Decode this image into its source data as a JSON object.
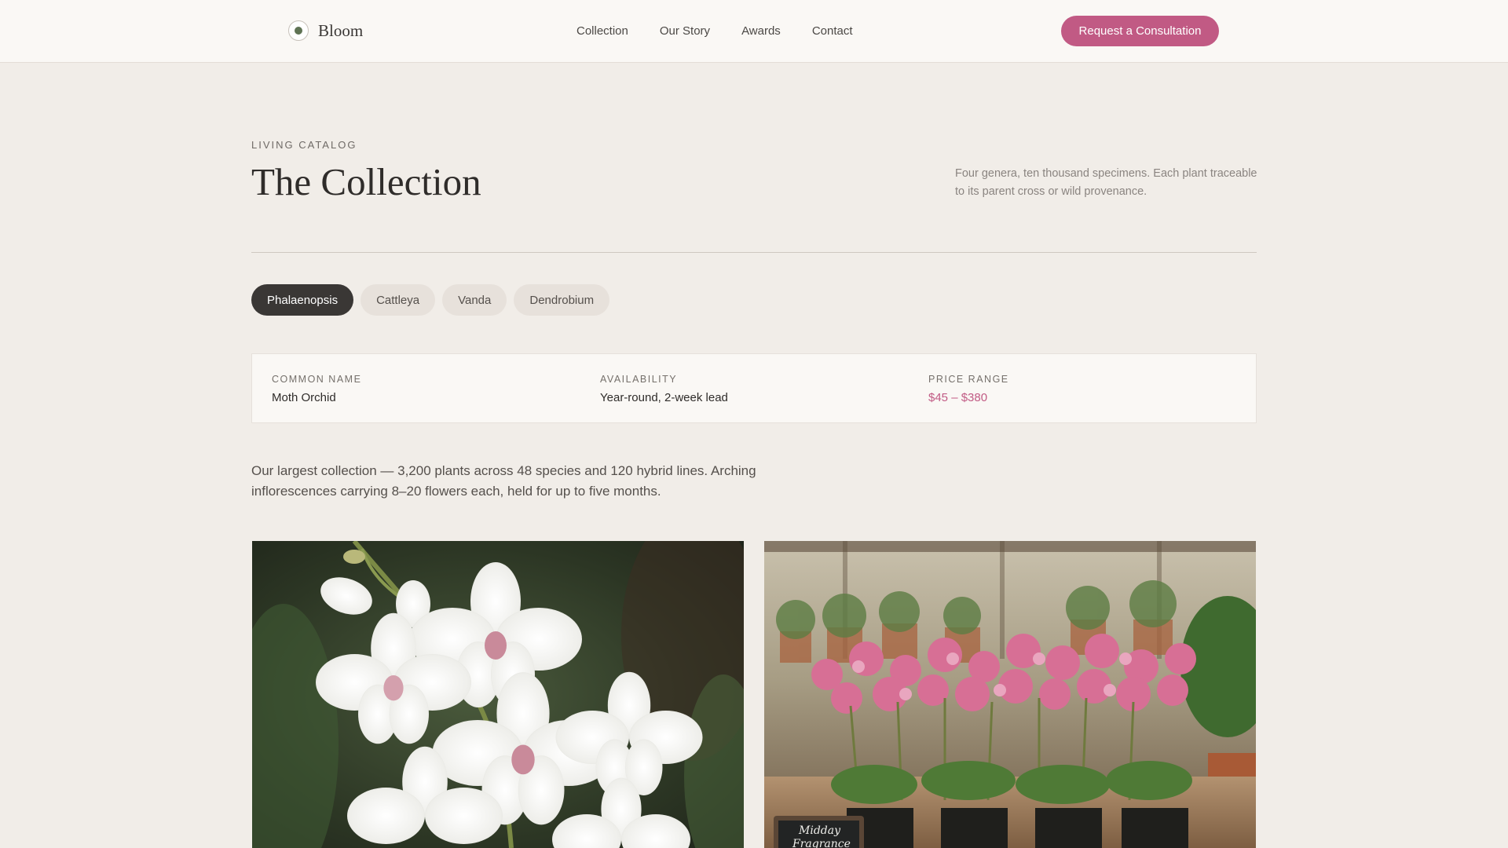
{
  "brand": {
    "name": "Bloom",
    "icon": "logo-mark-icon"
  },
  "nav": {
    "items": [
      "Collection",
      "Our Story",
      "Awards",
      "Contact"
    ]
  },
  "header": {
    "cta_label": "Request a Consultation"
  },
  "hero": {
    "eyebrow": "LIVING CATALOG",
    "title": "The Collection",
    "intro": "Four genera, ten thousand specimens. Each plant traceable to its parent cross or wild provenance."
  },
  "filters": {
    "items": [
      "Phalaenopsis",
      "Cattleya",
      "Vanda",
      "Dendrobium"
    ],
    "selected": "Phalaenopsis"
  },
  "info": {
    "common_name_label": "COMMON NAME",
    "common_name": "Moth Orchid",
    "availability_label": "AVAILABILITY",
    "availability": "Year-round, 2-week lead",
    "price_label": "PRICE RANGE",
    "price": "$45 – $380"
  },
  "description": "Our largest collection — 3,200 plants across 48 species and 120 hybrid lines. Arching inflorescences carrying 8–20 flowers each, held for up to five months.",
  "gallery": {
    "photo_2_sign": [
      "Midday",
      "Fragrance"
    ]
  },
  "colors": {
    "accent": "#c15a84",
    "dark": "#3a3735",
    "background": "#f1ede8",
    "brand_dot": "#5f7354"
  }
}
